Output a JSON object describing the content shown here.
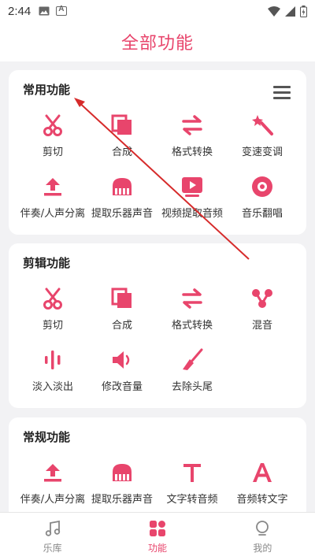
{
  "status_bar": {
    "time": "2:44"
  },
  "header": {
    "title": "全部功能"
  },
  "sections": [
    {
      "title": "常用功能",
      "items": [
        {
          "label": "剪切",
          "icon": "scissors-icon"
        },
        {
          "label": "合成",
          "icon": "merge-icon"
        },
        {
          "label": "格式转换",
          "icon": "convert-arrows-icon"
        },
        {
          "label": "变速变调",
          "icon": "magic-wand-icon"
        },
        {
          "label": "伴奏/人声分离",
          "icon": "upload-icon"
        },
        {
          "label": "提取乐器声音",
          "icon": "piano-icon"
        },
        {
          "label": "视频提取音频",
          "icon": "video-play-icon"
        },
        {
          "label": "音乐翻唱",
          "icon": "record-disc-icon"
        }
      ]
    },
    {
      "title": "剪辑功能",
      "items": [
        {
          "label": "剪切",
          "icon": "scissors-icon"
        },
        {
          "label": "合成",
          "icon": "merge-icon"
        },
        {
          "label": "格式转换",
          "icon": "convert-arrows-icon"
        },
        {
          "label": "混音",
          "icon": "mix-nodes-icon"
        },
        {
          "label": "淡入淡出",
          "icon": "waveform-icon"
        },
        {
          "label": "修改音量",
          "icon": "volume-icon"
        },
        {
          "label": "去除头尾",
          "icon": "brush-icon"
        }
      ]
    },
    {
      "title": "常规功能",
      "items": [
        {
          "label": "伴奏/人声分离",
          "icon": "upload-icon"
        },
        {
          "label": "提取乐器声音",
          "icon": "piano-icon"
        },
        {
          "label": "文字转音频",
          "icon": "text-t-icon"
        },
        {
          "label": "音频转文字",
          "icon": "letter-a-icon"
        }
      ]
    }
  ],
  "bottom_nav": [
    {
      "label": "乐库",
      "icon": "music-note-icon",
      "active": false
    },
    {
      "label": "功能",
      "icon": "grid-apps-icon",
      "active": true
    },
    {
      "label": "我的",
      "icon": "profile-icon",
      "active": false
    }
  ],
  "colors": {
    "accent": "#e8456c",
    "background": "#f2f2f4",
    "card": "#ffffff",
    "annotation": "#d62b2b"
  }
}
